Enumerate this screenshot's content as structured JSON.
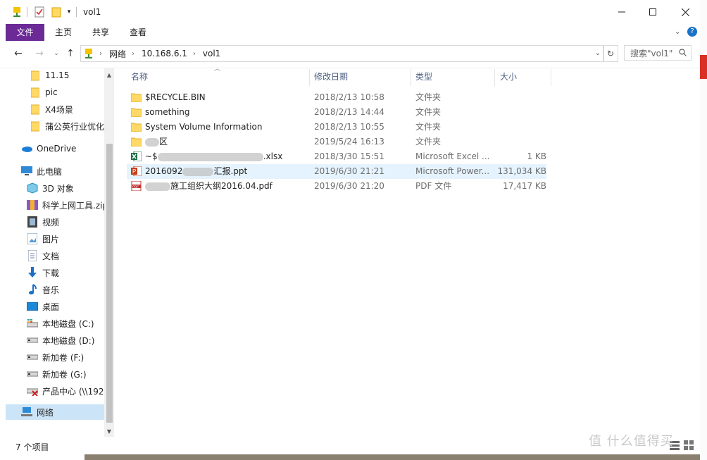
{
  "window": {
    "title": "vol1"
  },
  "ribbon": {
    "tabs": [
      "文件",
      "主页",
      "共享",
      "查看"
    ]
  },
  "address": {
    "crumbs": [
      "网络",
      "10.168.6.1",
      "vol1"
    ],
    "search_placeholder": "搜索\"vol1\""
  },
  "navpane": {
    "items": [
      {
        "label": "11.15",
        "icon": "folder-icon"
      },
      {
        "label": "pic",
        "icon": "folder-icon"
      },
      {
        "label": "X4场景",
        "icon": "folder-icon"
      },
      {
        "label": "蒲公英行业优化",
        "icon": "folder-icon"
      },
      {
        "label": "OneDrive",
        "icon": "onedrive-icon"
      },
      {
        "label": "此电脑",
        "icon": "computer-icon"
      },
      {
        "label": "3D 对象",
        "icon": "3d-objects-icon"
      },
      {
        "label": "科学上网工具.zip",
        "icon": "zip-icon"
      },
      {
        "label": "视频",
        "icon": "video-icon"
      },
      {
        "label": "图片",
        "icon": "pictures-icon"
      },
      {
        "label": "文档",
        "icon": "documents-icon"
      },
      {
        "label": "下载",
        "icon": "download-icon"
      },
      {
        "label": "音乐",
        "icon": "music-icon"
      },
      {
        "label": "桌面",
        "icon": "desktop-icon"
      },
      {
        "label": "本地磁盘 (C:)",
        "icon": "drive-c-icon"
      },
      {
        "label": "本地磁盘 (D:)",
        "icon": "drive-icon"
      },
      {
        "label": "新加卷 (F:)",
        "icon": "drive-icon"
      },
      {
        "label": "新加卷 (G:)",
        "icon": "drive-icon"
      },
      {
        "label": "产品中心 (\\\\192",
        "icon": "network-drive-disconnected-icon"
      },
      {
        "label": "网络",
        "icon": "network-icon"
      }
    ]
  },
  "list": {
    "columns": [
      "名称",
      "修改日期",
      "类型",
      "大小"
    ],
    "rows": [
      {
        "name": "$RECYCLE.BIN",
        "date": "2018/2/13 10:58",
        "type": "文件夹",
        "size": "",
        "icon": "folder-icon"
      },
      {
        "name": "something",
        "date": "2018/2/13 14:44",
        "type": "文件夹",
        "size": "",
        "icon": "folder-icon"
      },
      {
        "name": "System Volume Information",
        "date": "2018/2/13 10:55",
        "type": "文件夹",
        "size": "",
        "icon": "folder-icon"
      },
      {
        "name": "区",
        "date": "2019/5/24 16:13",
        "type": "文件夹",
        "size": "",
        "icon": "folder-icon"
      },
      {
        "name": "~$",
        "name_suffix": ".xlsx",
        "date": "2018/3/30 15:51",
        "type": "Microsoft Excel ...",
        "size": "1 KB",
        "icon": "excel-icon"
      },
      {
        "name": "2016092",
        "name_suffix": "汇报.ppt",
        "date": "2019/6/30 21:21",
        "type": "Microsoft Power...",
        "size": "131,034 KB",
        "icon": "powerpoint-icon"
      },
      {
        "name": "",
        "name_suffix": "施工组织大纲2016.04.pdf",
        "date": "2019/6/30 21:20",
        "type": "PDF 文件",
        "size": "17,417 KB",
        "icon": "pdf-icon"
      }
    ]
  },
  "status": {
    "count": "7 个项目"
  },
  "watermark": "值 什么值得买"
}
